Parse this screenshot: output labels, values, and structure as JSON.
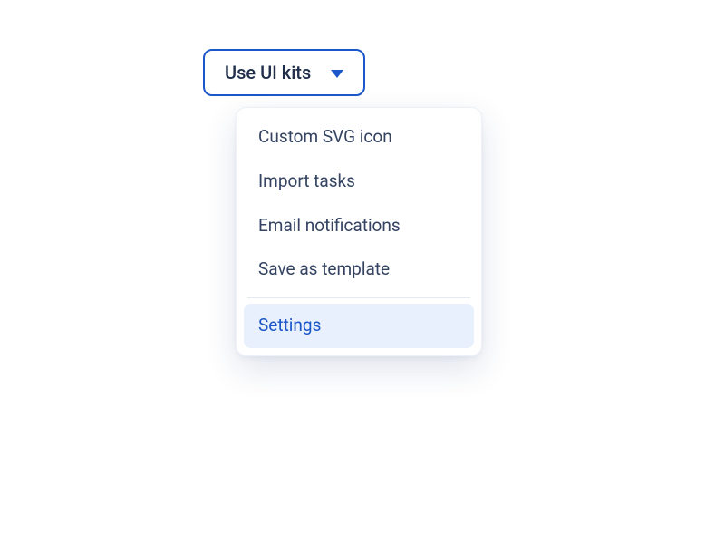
{
  "dropdown": {
    "trigger_label": "Use UI kits",
    "items": [
      {
        "label": "Custom SVG icon"
      },
      {
        "label": "Import tasks"
      },
      {
        "label": "Email notifications"
      },
      {
        "label": "Save as template"
      }
    ],
    "selected": {
      "label": "Settings"
    }
  }
}
